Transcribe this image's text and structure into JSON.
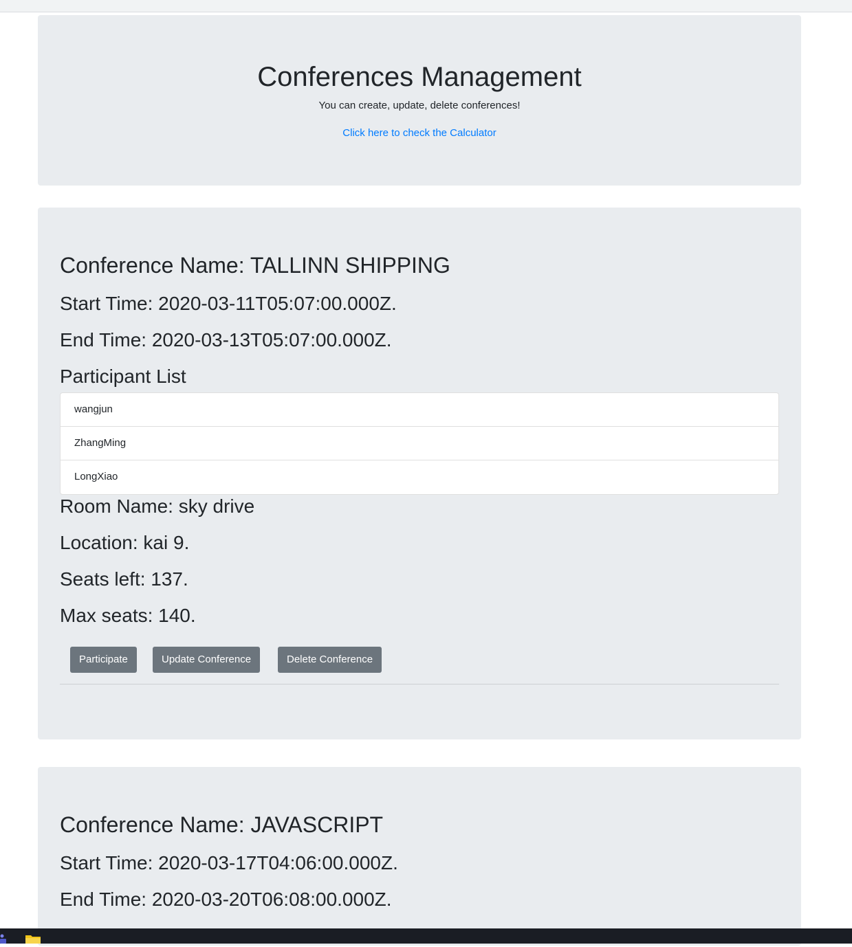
{
  "header": {
    "title": "Conferences Management",
    "subtitle": "You can create, update, delete conferences!",
    "link_text": "Click here to check the Calculator"
  },
  "conferences": [
    {
      "name_line": "Conference Name: TALLINN SHIPPING",
      "start_line": "Start Time: 2020-03-11T05:07:00.000Z.",
      "end_line": "End Time: 2020-03-13T05:07:00.000Z.",
      "participants_heading": "Participant List",
      "participants": [
        "wangjun",
        "ZhangMing",
        "LongXiao"
      ],
      "room_line": "Room Name: sky drive",
      "location_line": "Location: kai 9.",
      "seats_left_line": "Seats left: 137.",
      "max_seats_line": "Max seats: 140.",
      "buttons": {
        "participate": "Participate",
        "update": "Update Conference",
        "delete": "Delete Conference"
      }
    },
    {
      "name_line": "Conference Name: JAVASCRIPT",
      "start_line": "Start Time: 2020-03-17T04:06:00.000Z.",
      "end_line": "End Time: 2020-03-20T06:08:00.000Z."
    }
  ],
  "taskbar": {
    "icons": [
      "teams-icon",
      "file-explorer-icon"
    ]
  }
}
